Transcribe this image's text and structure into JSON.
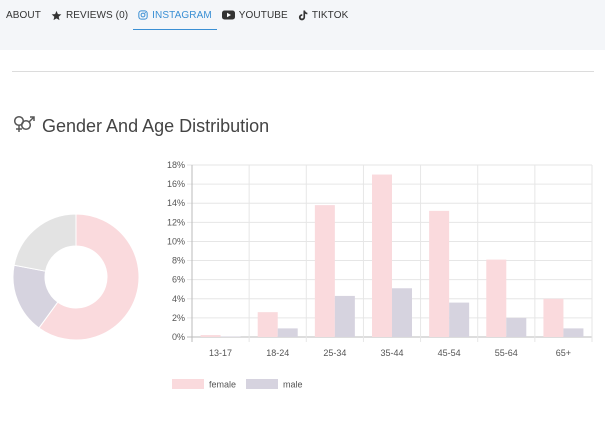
{
  "tabs": [
    {
      "label": "ABOUT",
      "icon": "none",
      "active": false
    },
    {
      "label": "REVIEWS (0)",
      "icon": "star-icon",
      "active": false
    },
    {
      "label": "INSTAGRAM",
      "icon": "instagram-icon",
      "active": true
    },
    {
      "label": "YOUTUBE",
      "icon": "youtube-icon",
      "active": false
    },
    {
      "label": "TIKTOK",
      "icon": "tiktok-icon",
      "active": false
    }
  ],
  "section": {
    "title": "Gender And Age Distribution",
    "icon": "gender-icon"
  },
  "colors": {
    "female": "#fadadd",
    "male": "#d6d3df",
    "other": "#e3e3e3",
    "accent": "#3a8fd4"
  },
  "chart_data": [
    {
      "type": "pie",
      "variant": "doughnut",
      "values": [
        60,
        18,
        22
      ],
      "colors": [
        "#fadadd",
        "#d6d3df",
        "#e3e3e3"
      ]
    },
    {
      "type": "bar",
      "categories": [
        "13-17",
        "18-24",
        "25-34",
        "35-44",
        "45-54",
        "55-64",
        "65+"
      ],
      "series": [
        {
          "name": "female",
          "values": [
            0.2,
            2.6,
            13.8,
            17.0,
            13.2,
            8.1,
            4.0
          ],
          "color": "#fadadd"
        },
        {
          "name": "male",
          "values": [
            0.05,
            0.9,
            4.3,
            5.1,
            3.6,
            2.0,
            0.9
          ],
          "color": "#d6d3df"
        }
      ],
      "ylim": [
        0,
        18
      ],
      "yticks": [
        "0%",
        "2%",
        "4%",
        "6%",
        "8%",
        "10%",
        "12%",
        "14%",
        "16%",
        "18%"
      ],
      "grid": true,
      "legend": "bottom-left"
    }
  ]
}
